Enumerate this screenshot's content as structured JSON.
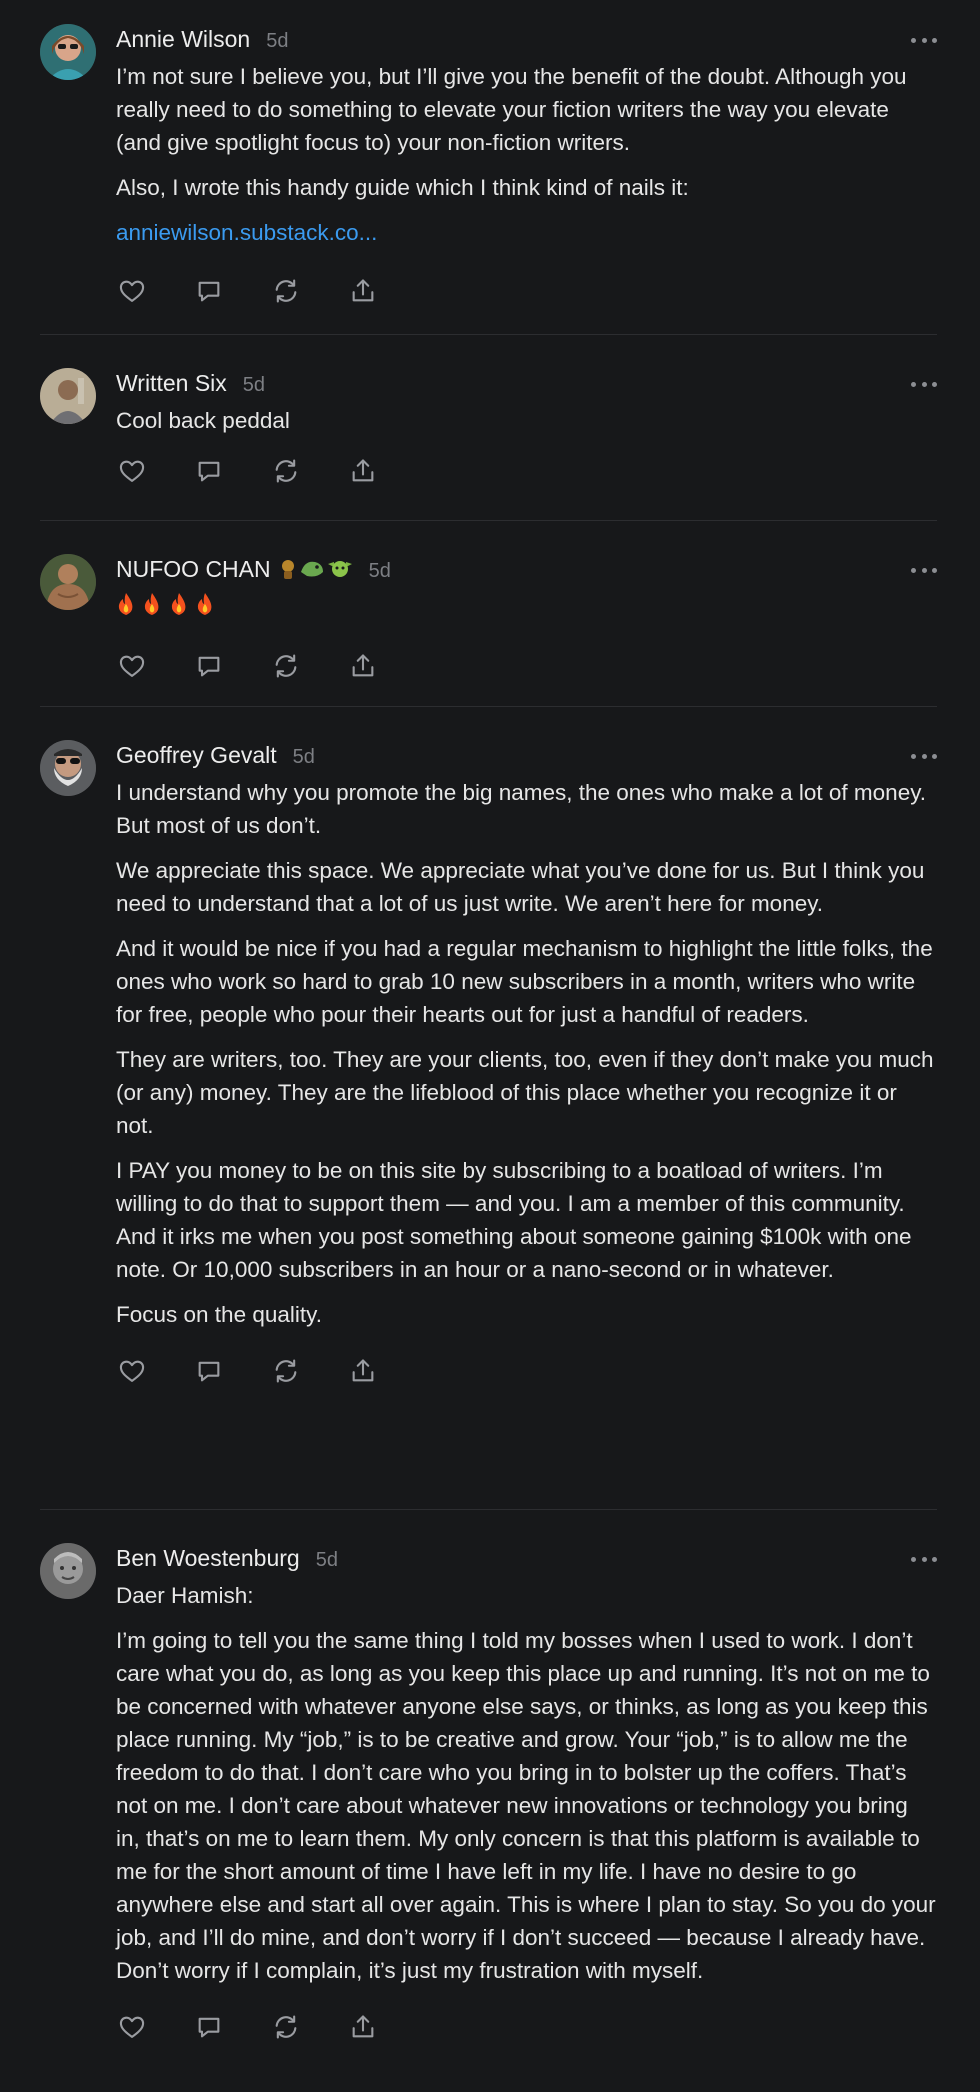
{
  "comments": [
    {
      "author": "Annie Wilson",
      "time": "5d",
      "paragraphs": [
        "I’m not sure I believe you, but I’ll give you the benefit of the doubt. Although you really need to do something to elevate your fiction writers the way you elevate (and give spotlight focus to) your non-fiction writers.",
        "Also, I wrote this handy guide which I think kind of nails it:"
      ],
      "link": "anniewilson.substack.co..."
    },
    {
      "author": "Written Six",
      "time": "5d",
      "paragraphs": [
        "Cool back peddal"
      ]
    },
    {
      "author": "NUFOO CHAN",
      "time": "5d",
      "paragraphs": []
    },
    {
      "author": "Geoffrey Gevalt",
      "time": "5d",
      "paragraphs": [
        "I understand why you promote the big names, the ones who make a lot of money. But most of us don’t.",
        "We appreciate this space. We appreciate what you’ve done for us. But I think you need to understand that a lot of us just write. We aren’t here for money.",
        "And it would be nice if you had a regular mechanism to highlight the little folks, the ones who work so hard to grab 10 new subscribers in a month, writers who write for free, people who pour their hearts out for just a handful of readers.",
        "They are writers, too. They are your clients, too, even if they don’t make you much (or any) money. They are the lifeblood of this place whether you recognize it or not.",
        "I PAY you money to be on this site by subscribing to a boatload of writers. I’m willing to do that to support them — and you. I am a member of this community. And it irks me when you post something about someone gaining $100k with one note. Or 10,000 subscribers in an hour or a nano-second or in whatever.",
        "Focus on the quality."
      ]
    },
    {
      "author": "Ben Woestenburg",
      "time": "5d",
      "paragraphs": [
        "Daer Hamish:",
        "I’m going to tell you the same thing I told my bosses when I used to work. I don’t care what you do, as long as you keep this place up and running. It’s not on me to be concerned with whatever anyone else says, or thinks, as long as you keep this place running. My “job,” is to be creative and grow. Your “job,” is to allow me the freedom to do that. I don’t care who you bring in to bolster up the coffers. That’s not on me. I don’t care about whatever new innovations or technology you bring in, that’s on me to learn them. My only concern is that this platform is available to me for the short amount of time I have left in my life. I have no desire to go anywhere else and start all over again. This is where I plan to stay. So you do your job, and I’ll do mine, and don’t worry if I don’t succeed — because I already have. Don’t worry if I complain, it’s just my frustration with myself."
      ]
    }
  ],
  "colors": {
    "background": "#17181a",
    "text": "#e6e6e6",
    "muted": "#7d7f84",
    "link": "#3b9bf0",
    "icon": "#9a9ca1",
    "divider": "#2c2d30"
  },
  "icons": [
    "heart-icon",
    "comment-icon",
    "restack-icon",
    "share-icon",
    "more-icon"
  ]
}
